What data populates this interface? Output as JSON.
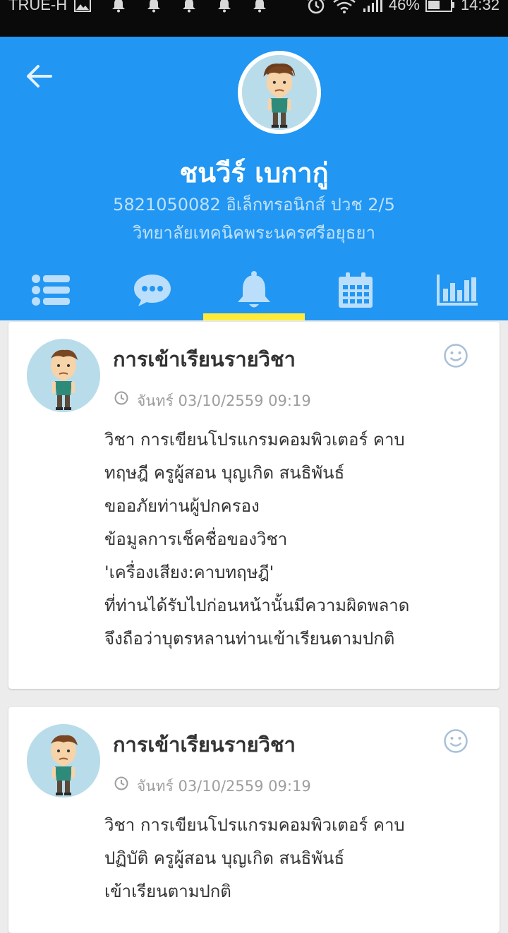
{
  "status_bar": {
    "carrier": "TRUE-H",
    "battery": "46%",
    "time": "14:32"
  },
  "profile": {
    "name": "ชนวีร์ เบกากู่",
    "id_line": "5821050082 อิเล็กทรอนิกส์ ปวช 2/5",
    "school": "วิทยาลัยเทคนิคพระนครศรีอยุธยา"
  },
  "tabs": [
    {
      "icon": "list-icon"
    },
    {
      "icon": "chat-icon"
    },
    {
      "icon": "bell-icon",
      "active": true
    },
    {
      "icon": "calendar-icon"
    },
    {
      "icon": "bar-chart-icon"
    }
  ],
  "colors": {
    "header": "#2196f3",
    "indicator": "#ffeb3b",
    "avatar_bg": "#b9dcea"
  },
  "cards": [
    {
      "title": "การเข้าเรียนรายวิชา",
      "time": "จันทร์ 03/10/2559  09:19",
      "lines": [
        "วิชา การเขียนโปรแกรมคอมพิวเตอร์ คาบ",
        "ทฤษฎี ครูผู้สอน บุญเกิด สนธิพันธ์",
        "ขออภัยท่านผู้ปกครอง",
        "ข้อมูลการเช็คชื่อของวิชา",
        "'เครื่องเสียง:คาบทฤษฎี'",
        "ที่ท่านได้รับไปก่อนหน้านั้นมีความผิดพลาด",
        "จึงถือว่าบุตรหลานท่านเข้าเรียนตามปกติ"
      ]
    },
    {
      "title": "การเข้าเรียนรายวิชา",
      "time": "จันทร์ 03/10/2559  09:19",
      "lines": [
        "วิชา การเขียนโปรแกรมคอมพิวเตอร์ คาบ",
        "ปฏิบัติ ครูผู้สอน บุญเกิด สนธิพันธ์",
        "เข้าเรียนตามปกติ"
      ]
    }
  ]
}
